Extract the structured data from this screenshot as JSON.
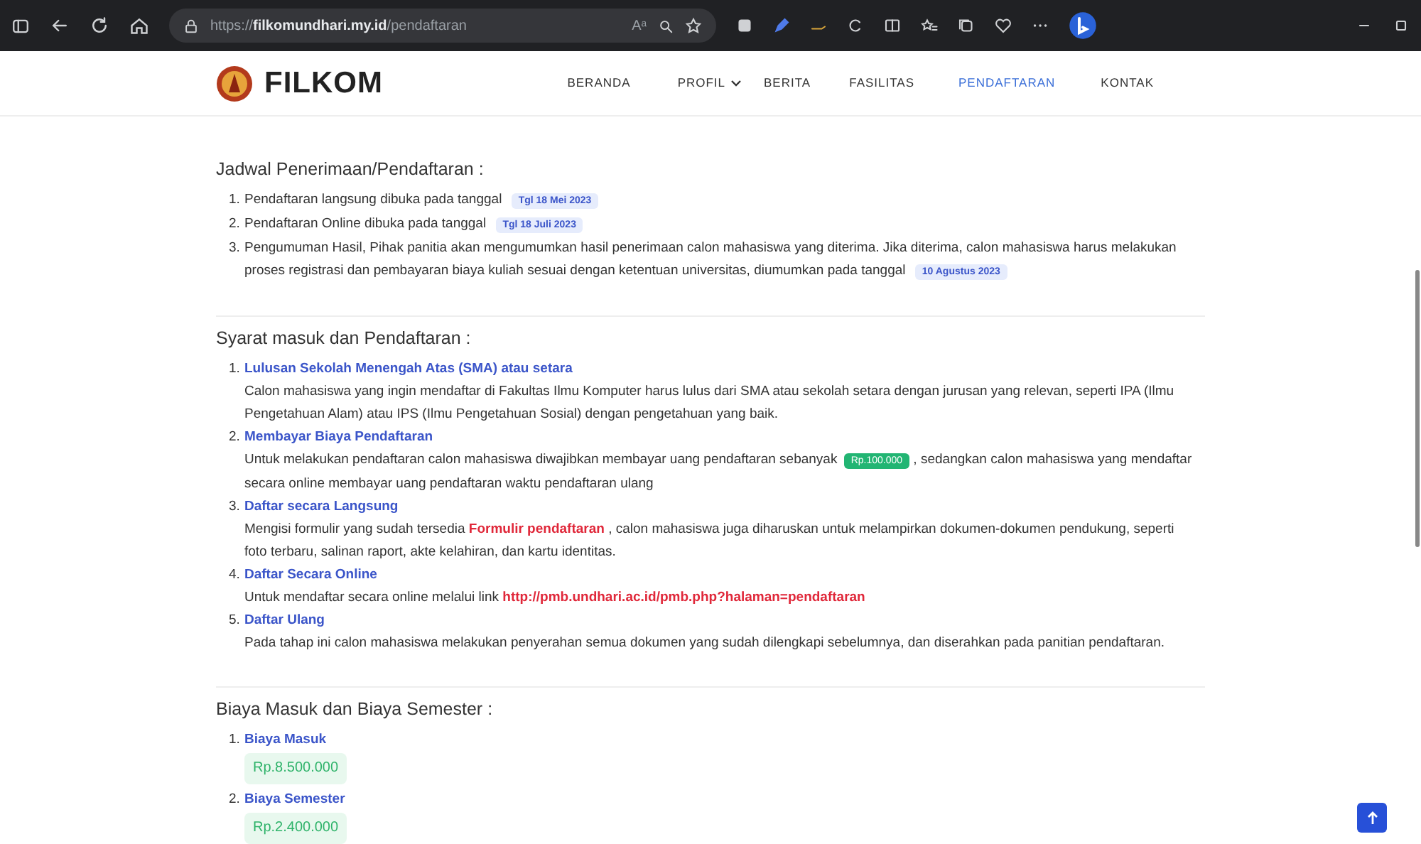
{
  "browser": {
    "url_scheme": "https://",
    "url_host": "filkomundhari.my.id",
    "url_path": "/pendaftaran",
    "read_aloud": "Aᵃ"
  },
  "navbar": {
    "brand": "FILKOM",
    "items": [
      {
        "label": "BERANDA",
        "selected": false,
        "dropdown": false
      },
      {
        "label": "PROFIL",
        "selected": false,
        "dropdown": true
      },
      {
        "label": "BERITA",
        "selected": false,
        "dropdown": false
      },
      {
        "label": "FASILITAS",
        "selected": false,
        "dropdown": false
      },
      {
        "label": "PENDAFTARAN",
        "selected": true,
        "dropdown": false
      },
      {
        "label": "KONTAK",
        "selected": false,
        "dropdown": false
      }
    ]
  },
  "sections": [
    {
      "kind": "schedule",
      "title": "Jadwal Penerimaan/Pendaftaran :",
      "items": [
        {
          "number": "1.",
          "parts": [
            {
              "kind": "text",
              "text": "Pendaftaran langsung dibuka pada tanggal"
            },
            {
              "kind": "date",
              "text": "Tgl 18 Mei 2023"
            }
          ]
        },
        {
          "number": "2.",
          "parts": [
            {
              "kind": "text",
              "text": "Pendaftaran Online dibuka pada tanggal"
            },
            {
              "kind": "date",
              "text": "Tgl 18 Juli 2023"
            }
          ]
        },
        {
          "number": "3.",
          "parts": [
            {
              "kind": "text",
              "text": "Pengumuman Hasil, Pihak panitia akan mengumumkan hasil penerimaan calon mahasiswa yang diterima. Jika diterima, calon mahasiswa harus melakukan proses registrasi dan pembayaran biaya kuliah sesuai dengan ketentuan universitas, diumumkan pada tanggal"
            },
            {
              "kind": "date",
              "text": "10 Agustus 2023"
            }
          ]
        }
      ]
    },
    {
      "kind": "requirements",
      "title": "Syarat masuk dan Pendaftaran :",
      "items": [
        {
          "number": "1.",
          "title": "Lulusan Sekolah Menengah Atas (SMA) atau setara",
          "parts": [
            {
              "kind": "text",
              "text": "Calon mahasiswa yang ingin mendaftar di Fakultas Ilmu Komputer harus lulus dari SMA atau sekolah setara dengan jurusan yang relevan, seperti IPA (Ilmu Pengetahuan Alam) atau IPS (Ilmu Pengetahuan Sosial) dengan pengetahuan yang baik."
            }
          ]
        },
        {
          "number": "2.",
          "title": "Membayar Biaya Pendaftaran",
          "parts": [
            {
              "kind": "text",
              "text": "Untuk melakukan pendaftaran calon mahasiswa diwajibkan membayar uang pendaftaran sebanyak"
            },
            {
              "kind": "money",
              "text": "Rp.100.000"
            },
            {
              "kind": "text",
              "text": ", sedangkan calon mahasiswa yang mendaftar secara online membayar uang pendaftaran waktu pendaftaran ulang"
            }
          ]
        },
        {
          "number": "3.",
          "title": "Daftar secara Langsung",
          "parts": [
            {
              "kind": "text",
              "text": "Mengisi formulir yang sudah tersedia"
            },
            {
              "kind": "link",
              "text": "Formulir pendaftaran"
            },
            {
              "kind": "text",
              "text": ", calon mahasiswa juga diharuskan untuk melampirkan dokumen-dokumen pendukung, seperti foto terbaru, salinan raport, akte kelahiran, dan kartu identitas."
            }
          ]
        },
        {
          "number": "4.",
          "title": "Daftar Secara Online",
          "parts": [
            {
              "kind": "text",
              "text": "Untuk mendaftar secara online melalui link"
            },
            {
              "kind": "link",
              "text": "http://pmb.undhari.ac.id/pmb.php?halaman=pendaftaran"
            }
          ]
        },
        {
          "number": "5.",
          "title": "Daftar Ulang",
          "parts": [
            {
              "kind": "text",
              "text": "Pada tahap ini calon mahasiswa melakukan penyerahan semua dokumen yang sudah dilengkapi sebelumnya, dan diserahkan pada panitian pendaftaran."
            }
          ]
        }
      ]
    },
    {
      "kind": "fees",
      "title": "Biaya Masuk dan Biaya Semester :",
      "items": [
        {
          "number": "1.",
          "title": "Biaya Masuk",
          "amount": "Rp.8.500.000"
        },
        {
          "number": "2.",
          "title": "Biaya Semester",
          "amount": "Rp.2.400.000"
        }
      ]
    }
  ]
}
